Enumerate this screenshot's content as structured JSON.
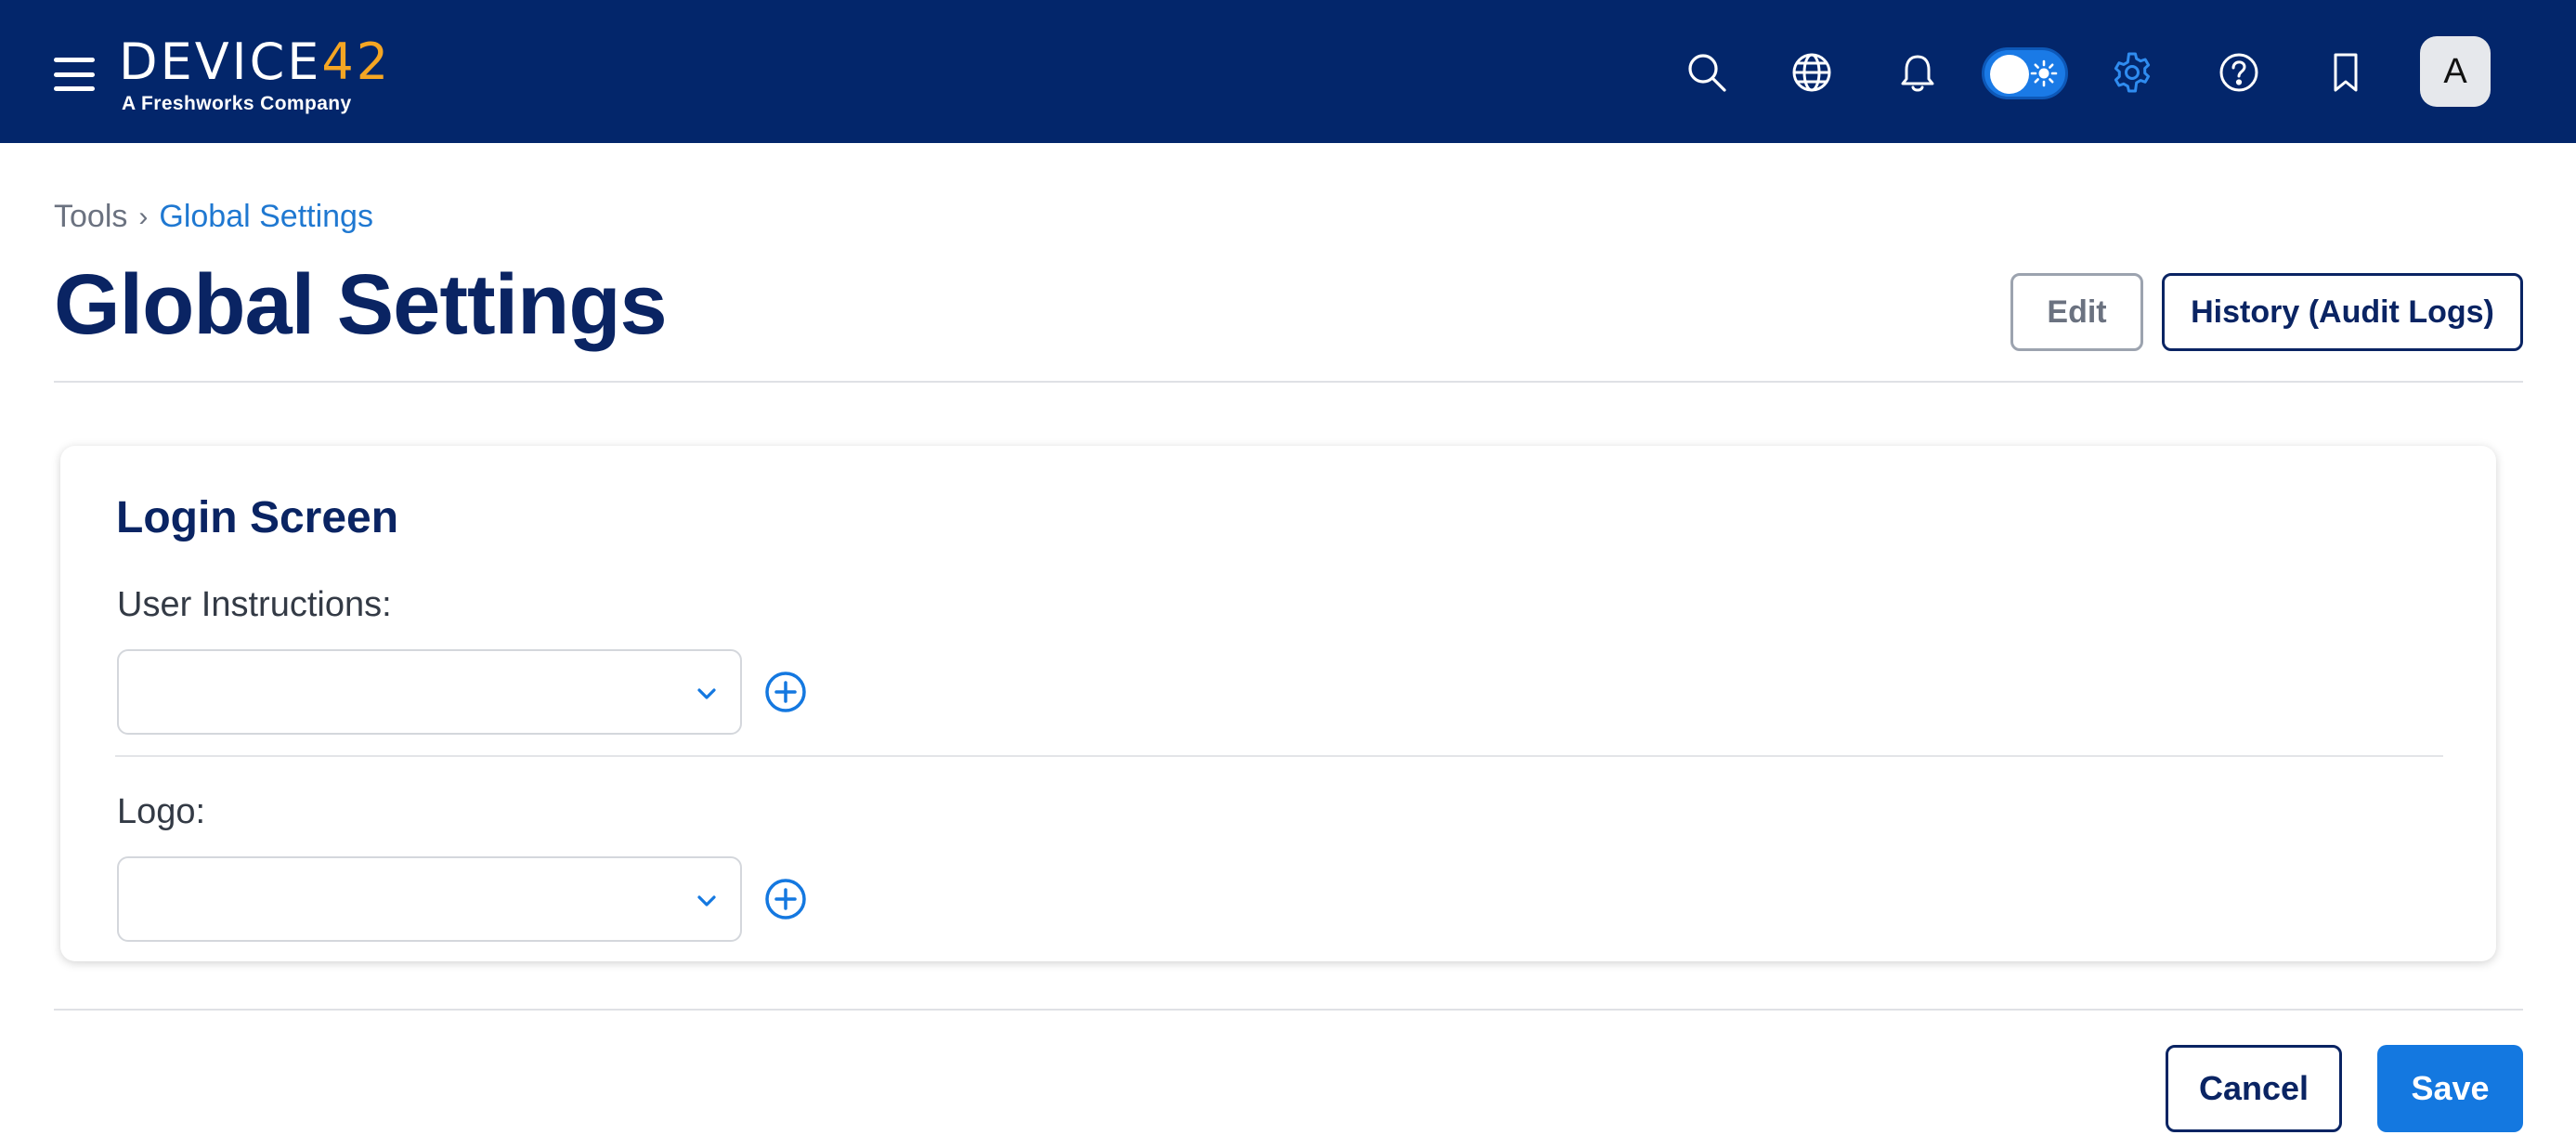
{
  "header": {
    "logo": {
      "brand_main": "DEVICE",
      "brand_accent": "42",
      "tagline": "A Freshworks Company"
    },
    "icons": [
      "menu-icon",
      "search-icon",
      "globe-icon",
      "bell-icon",
      "theme-toggle",
      "gear-icon",
      "help-icon",
      "bookmark-icon"
    ],
    "avatar_initial": "A",
    "accent_color": "#f5a623",
    "bar_color": "#03266b"
  },
  "breadcrumb": {
    "parent": "Tools",
    "separator": "›",
    "current": "Global Settings"
  },
  "page": {
    "title": "Global Settings",
    "edit_label": "Edit",
    "history_label": "History (Audit Logs)"
  },
  "card": {
    "title": "Login Screen",
    "fields": [
      {
        "label": "User Instructions:",
        "value": ""
      },
      {
        "label": "Logo:",
        "value": ""
      }
    ]
  },
  "footer": {
    "cancel_label": "Cancel",
    "save_label": "Save"
  },
  "colors": {
    "primary": "#1478e0",
    "navy": "#0a2463"
  }
}
